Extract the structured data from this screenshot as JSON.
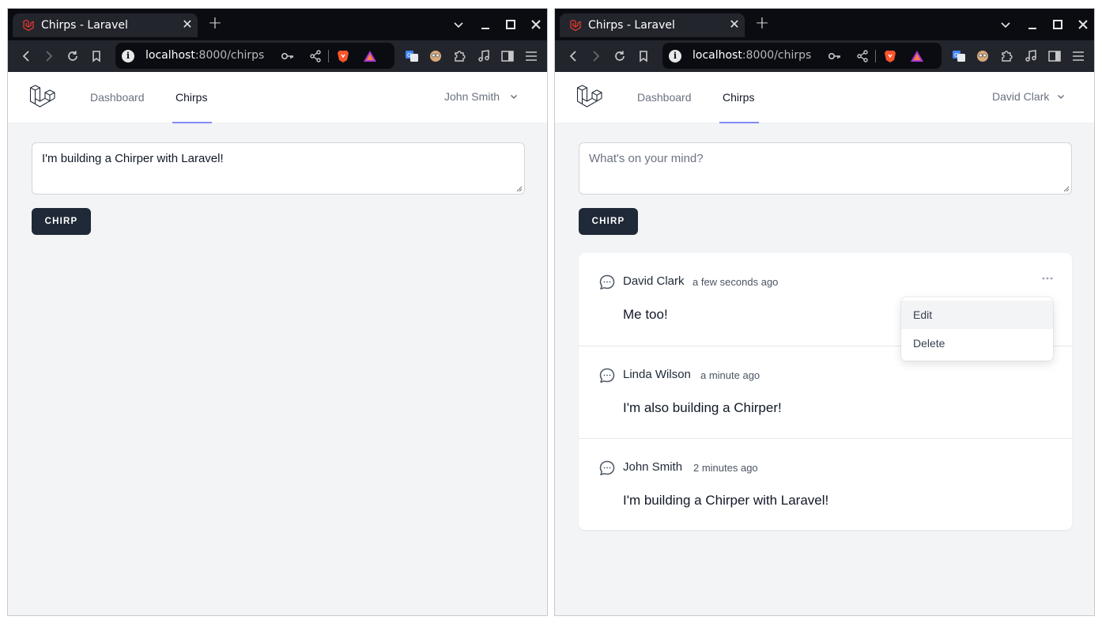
{
  "windows": [
    {
      "id": "left",
      "tab_title": "Chirps - Laravel",
      "url_host": "localhost",
      "url_rest": ":8000/chirps",
      "nav": {
        "dashboard": "Dashboard",
        "chirps": "Chirps",
        "user": "John Smith"
      },
      "form": {
        "value": "I'm building a Chirper with Laravel!",
        "button": "CHIRP"
      }
    },
    {
      "id": "right",
      "tab_title": "Chirps - Laravel",
      "url_host": "localhost",
      "url_rest": ":8000/chirps",
      "nav": {
        "dashboard": "Dashboard",
        "chirps": "Chirps",
        "user": "David Clark"
      },
      "form": {
        "placeholder": "What's on your mind?",
        "button": "CHIRP"
      },
      "chirps": [
        {
          "author": "David Clark",
          "time": "a few seconds ago",
          "message": "Me too!"
        },
        {
          "author": "Linda Wilson",
          "time": "a minute ago",
          "message": "I'm also building a Chirper!"
        },
        {
          "author": "John Smith",
          "time": "2 minutes ago",
          "message": "I'm building a Chirper with Laravel!"
        }
      ],
      "dropdown": {
        "edit": "Edit",
        "delete": "Delete"
      }
    }
  ],
  "colors": {
    "accent_underline": "#818cf8",
    "button_bg": "#1f2937",
    "page_bg": "#f3f4f6",
    "browser_dark": "#0b0c12",
    "laravel_red": "#ef3b2d"
  }
}
